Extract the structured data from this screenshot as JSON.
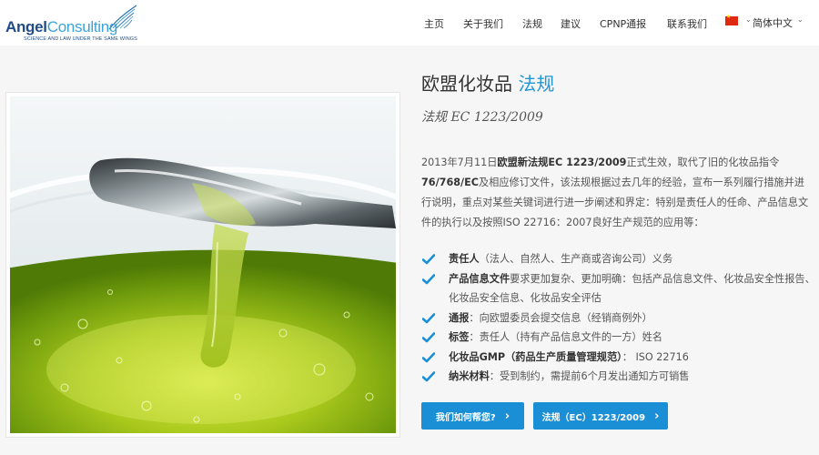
{
  "brand": {
    "name_part1": "Angel",
    "name_part2": "Consulting",
    "tagline": "SCIENCE AND LAW UNDER THE SAME WINGS"
  },
  "nav": {
    "items": [
      {
        "label": "主页"
      },
      {
        "label": "关于我们"
      },
      {
        "label": "法规"
      },
      {
        "label": "建议"
      },
      {
        "label": "CPNP通报"
      },
      {
        "label": "联系我们"
      }
    ],
    "language": {
      "label": "简体中文",
      "flag": "china-flag-icon"
    }
  },
  "hero": {
    "title_main": "欧盟化妆品",
    "title_highlight": "法规",
    "subtitle": "法规 EC 1223/2009",
    "intro": {
      "part1": "2013年7月11日",
      "part2_bold": "欧盟新法规EC 1223/2009",
      "part3": "正式生效，取代了旧的化妆品指令",
      "part4_bold": "76/768/EC",
      "part5": "及相应修订文件，该法规根据过去几年的经验，宣布一系列履行措施并进行说明，重点对某些关键词进行进一步阐述和界定：特别是责任人的任命、产品信息文件的执行以及按照ISO 22716：2007良好生产规范的应用等："
    },
    "bullets": [
      {
        "bold": "责任人",
        "text": "（法人、自然人、生产商或咨询公司）义务"
      },
      {
        "bold": "产品信息文件",
        "text": "要求更加复杂、更加明确：包括产品信息文件、化妆品安全性报告、化妆品安全信息、化妆品安全评估"
      },
      {
        "bold": "通报",
        "text": "：向欧盟委员会提交信息（经销商例外）"
      },
      {
        "bold": "标签",
        "text": "：责任人（持有产品信息文件的一方）姓名"
      },
      {
        "bold": "化妆品GMP（药品生产质量管理规范）",
        "text": "：  ISO 22716"
      },
      {
        "bold": "纳米材料",
        "text": "：受到制约，需提前6个月发出通知方可销售"
      }
    ],
    "buttons": {
      "help": "我们如何帮您?",
      "regulation": "法规（EC）1223/2009"
    }
  },
  "colors": {
    "accent": "#2196d6",
    "button": "#1a8fd6",
    "check": "#1a8fd6",
    "logo_dark": "#1f4c87",
    "logo_light": "#3aa3d8"
  }
}
